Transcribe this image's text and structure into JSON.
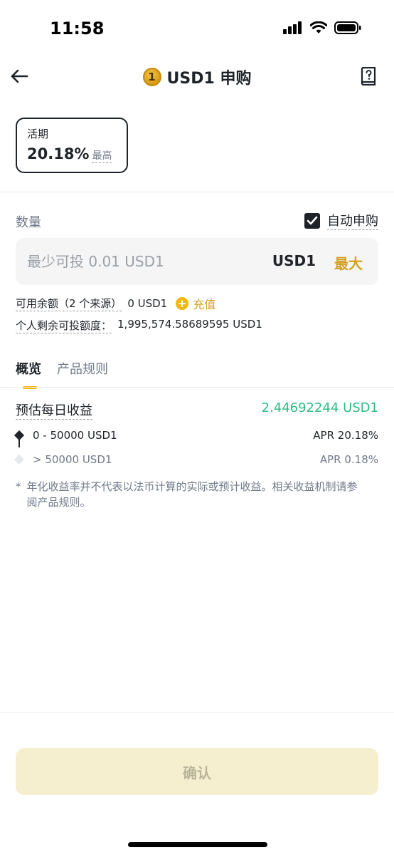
{
  "status_bar": {
    "time": "11:58",
    "signal_icon": "signal-icon",
    "wifi_icon": "wifi-icon",
    "battery_icon": "battery-icon"
  },
  "nav": {
    "title": "USD1 申购",
    "coin_glyph": "1",
    "back_icon": "arrow-left-icon",
    "guide_icon": "book-question-icon"
  },
  "plan_card": {
    "label": "活期",
    "rate": "20.18%",
    "tag": "最高"
  },
  "amount": {
    "label": "数量",
    "auto_subscribe_label": "自动申购",
    "auto_subscribe_checked": true,
    "placeholder": "最少可投 0.01 USD1",
    "value": "",
    "unit": "USD1",
    "max_label": "最大"
  },
  "available": {
    "label": "可用余额（2 个来源）",
    "value": "0 USD1",
    "deposit_label": "充值"
  },
  "quota": {
    "label": "个人剩余可投额度：",
    "value": "1,995,574.58689595 USD1"
  },
  "tabs": [
    {
      "label": "概览",
      "active": true
    },
    {
      "label": "产品规则",
      "active": false
    }
  ],
  "estimate": {
    "label": "预估每日收益",
    "value": "2.44692244 USD1"
  },
  "tiers": [
    {
      "range": "0 - 50000 USD1",
      "apr": "APR 20.18%"
    },
    {
      "range": "> 50000 USD1",
      "apr": "APR 0.18%"
    }
  ],
  "note": {
    "marker": "*",
    "text": "年化收益率并不代表以法币计算的实际或预计收益。相关收益机制请参阅产品规则。"
  },
  "confirm": {
    "label": "确认"
  },
  "colors": {
    "accent": "#F0B90B",
    "accent_text": "#D2A024",
    "positive": "#2EBD85",
    "confirm_bg": "#F6EFCF"
  }
}
